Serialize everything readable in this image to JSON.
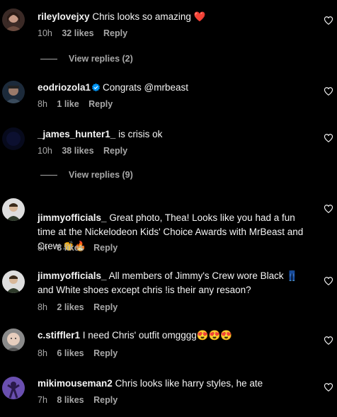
{
  "comments": [
    {
      "username": "rileylovejxy",
      "text": "Chris looks so amazing ❤️",
      "time": "10h",
      "likes": "32 likes",
      "reply": "Reply",
      "view_replies": "View replies (2)"
    },
    {
      "username": "eodriozola1",
      "text": "Congrats @mrbeast",
      "time": "8h",
      "likes": "1 like",
      "reply": "Reply"
    },
    {
      "username": "_james_hunter1_",
      "text": "is crisis ok",
      "time": "10h",
      "likes": "38 likes",
      "reply": "Reply",
      "view_replies": "View replies (9)"
    },
    {
      "username": "jimmyofficials_",
      "text": "Great photo, Thea! Looks like you had a fun time at the Nickelodeon Kids' Choice Awards with MrBeast and Crew 👏🔥",
      "time": "8h",
      "likes": "3 likes",
      "reply": "Reply"
    },
    {
      "username": "jimmyofficials_",
      "text": "All members of Jimmy's Crew wore Black 👖 and White shoes except chris !is their any resaon?",
      "time": "8h",
      "likes": "2 likes",
      "reply": "Reply"
    },
    {
      "username": "c.stiffler1",
      "text": "I need Chris' outfit omgggg😍😍😍",
      "time": "8h",
      "likes": "6 likes",
      "reply": "Reply"
    },
    {
      "username": "mikimouseman2",
      "text": "Chris looks like harry styles, he ate",
      "time": "7h",
      "likes": "8 likes",
      "reply": "Reply"
    }
  ],
  "colors": {
    "background": "#000000",
    "text": "#f5f5f5",
    "secondary": "#a8a8a8",
    "verified": "#0095f6",
    "heart_emoji": "#ed1d3a"
  },
  "icons": {
    "like": "heart-outline-icon",
    "verified": "verified-badge-icon"
  }
}
